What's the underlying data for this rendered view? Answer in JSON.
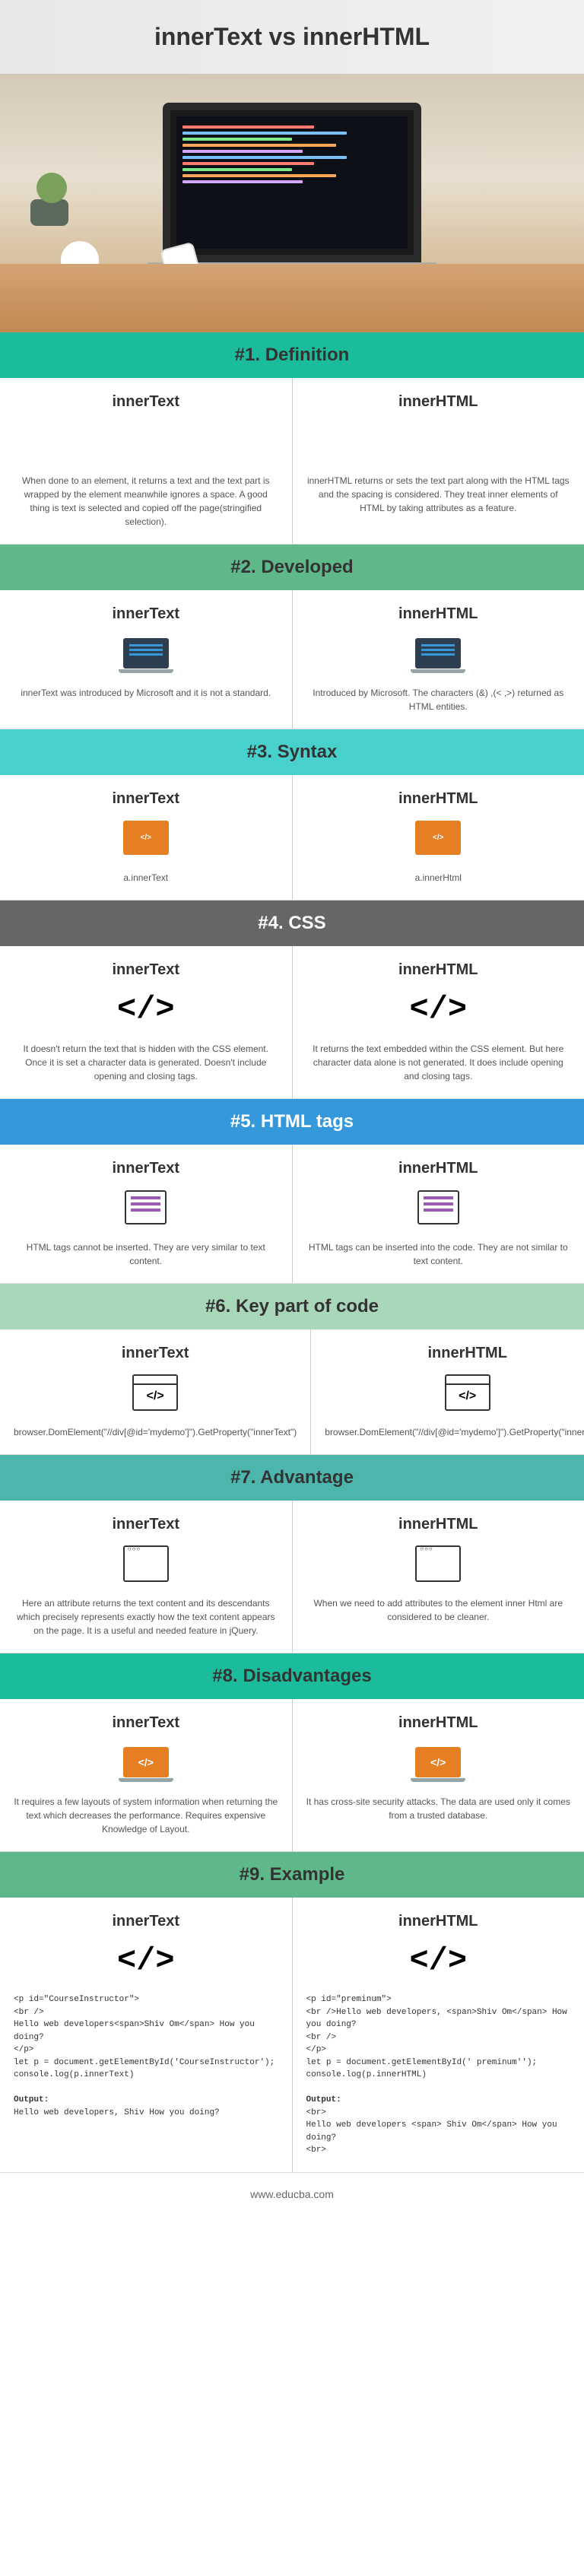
{
  "title": "innerText vs innerHTML",
  "sections": [
    {
      "num": "#1.",
      "label": "Definition",
      "bar": "bar-teal-dark",
      "icon": "icon-painter",
      "left": {
        "h": "innerText",
        "p": "When done to an element, it returns a text and the text part is wrapped by the element meanwhile ignores a space. A good thing is text is selected and copied off the page(stringified selection)."
      },
      "right": {
        "h": "innerHTML",
        "p": "innerHTML returns or sets the text part along with the HTML tags and the spacing is considered. They treat inner elements of HTML by taking attributes as a feature."
      }
    },
    {
      "num": "#2.",
      "label": "Developed",
      "bar": "bar-green",
      "icon": "icon-laptop icon-laptop-lines",
      "left": {
        "h": "innerText",
        "p": "innerText was introduced by Microsoft and it is not a standard."
      },
      "right": {
        "h": "innerHTML",
        "p": "Introduced by Microsoft. The characters (&) ,(< ,>) returned as HTML entities."
      }
    },
    {
      "num": "#3.",
      "label": "Syntax",
      "bar": "bar-teal-light",
      "icon": "icon-code-orange",
      "left": {
        "h": "innerText",
        "p": "a.innerText"
      },
      "right": {
        "h": "innerHTML",
        "p": "a.innerHtml"
      }
    },
    {
      "num": "#4.",
      "label": "CSS",
      "bar": "bar-gray",
      "icon": "icon-code-tags",
      "left": {
        "h": "innerText",
        "p": "It doesn't return the text that is hidden with the CSS element. Once it is set a character data is generated. Doesn't include opening and closing tags."
      },
      "right": {
        "h": "innerHTML",
        "p": "It returns the text embedded within the CSS element. But here character data alone is not generated. It does include opening and closing tags."
      }
    },
    {
      "num": "#5.",
      "label": "HTML tags",
      "bar": "bar-blue",
      "icon": "icon-purple-doc",
      "left": {
        "h": "innerText",
        "p": "HTML tags cannot be inserted. They are very similar to text content."
      },
      "right": {
        "h": "innerHTML",
        "p": "HTML tags can be inserted into the code. They are not similar to text content."
      }
    },
    {
      "num": "#6.",
      "label": "Key part of code",
      "bar": "bar-pale-green",
      "icon": "icon-window-code",
      "left": {
        "h": "innerText",
        "p": "browser.DomElement(\"//div[@id='mydemo']\").GetProperty(\"innerText\")"
      },
      "right": {
        "h": "innerHTML",
        "p": "browser.DomElement(\"//div[@id='mydemo']\").GetProperty(\"innerHtml\")"
      }
    },
    {
      "num": "#7.",
      "label": "Advantage",
      "bar": "bar-green-mid",
      "icon": "icon-window-blank",
      "left": {
        "h": "innerText",
        "p": "Here an attribute returns the text content and its descendants which precisely represents exactly how the text content appears on the page. It is a useful and needed feature in jQuery."
      },
      "right": {
        "h": "innerHTML",
        "p": "When we need to add attributes to the element inner Html are considered to be cleaner."
      }
    },
    {
      "num": "#8.",
      "label": "Disadvantages",
      "bar": "bar-teal-dark",
      "icon": "icon-laptop-orange",
      "left": {
        "h": "innerText",
        "p": "It requires a few layouts of system information when returning the text which decreases the performance. Requires expensive Knowledge of Layout."
      },
      "right": {
        "h": "innerHTML",
        "p": "It has cross-site security attacks. The data are used only it comes from a trusted database."
      }
    },
    {
      "num": "#9.",
      "label": "Example",
      "bar": "bar-green",
      "icon": "icon-code-tags",
      "left": {
        "h": "innerText",
        "pre": "<p id=\"CourseInstructor\">\n<br />\nHello web developers<span>Shiv Om</span> How you doing?\n</p>\nlet p = document.getElementById('CourseInstructor');\nconsole.log(p.innerText)\n\nOutput:\nHello web developers, Shiv How you doing?"
      },
      "right": {
        "h": "innerHTML",
        "pre": "<p id=\"preminum\">\n<br />Hello web developers, <span>Shiv Om</span> How you doing?\n<br />\n</p>\nlet p = document.getElementById(' preminum'');\nconsole.log(p.innerHTML)\n\nOutput:\n<br>\nHello web developers <span> Shiv Om</span> How you doing?\n<br>"
      }
    }
  ],
  "footer": "www.educba.com"
}
